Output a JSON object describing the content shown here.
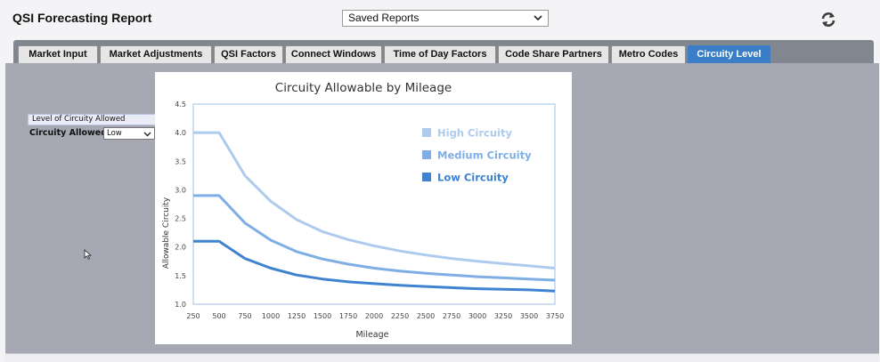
{
  "app": {
    "title": "QSI Forecasting Report",
    "saved_reports_value": "Saved Reports"
  },
  "tabs": [
    {
      "label": "Market Input",
      "active": false
    },
    {
      "label": "Market Adjustments",
      "active": false
    },
    {
      "label": "QSI Factors",
      "active": false
    },
    {
      "label": "Connect Windows",
      "active": false
    },
    {
      "label": "Time of Day Factors",
      "active": false
    },
    {
      "label": "Code Share Partners",
      "active": false
    },
    {
      "label": "Metro Codes",
      "active": false
    },
    {
      "label": "Circuity Level",
      "active": true
    }
  ],
  "circuity_panel": {
    "header": "Level of Circuity Allowed",
    "label": "Circuity Allowed",
    "selected": "Low"
  },
  "icons": {
    "refresh": "refresh-icon",
    "dropdown": "chevron-down-icon",
    "cursor": "mouse-pointer-icon"
  },
  "colors": {
    "tab_active": "#3b7ec8",
    "panel_bg": "#a6a9b3",
    "high": "#aecbee",
    "medium": "#7eaee3",
    "low": "#3f82d0"
  },
  "chart_data": {
    "type": "line",
    "title": "Circuity Allowable by Mileage",
    "xlabel": "Mileage",
    "ylabel": "Allowable Circuity",
    "xlim": [
      250,
      3750
    ],
    "ylim": [
      1.0,
      4.5
    ],
    "xticks": [
      "250",
      "500",
      "750",
      "1000",
      "1250",
      "1500",
      "1750",
      "2000",
      "2250",
      "2500",
      "2750",
      "3000",
      "3250",
      "3500",
      "3750"
    ],
    "yticks": [
      "1.0",
      "1.5",
      "2.0",
      "2.5",
      "3.0",
      "3.5",
      "4.0",
      "4.5"
    ],
    "grid": false,
    "legend_position": "top-right",
    "x": [
      250,
      500,
      750,
      1000,
      1250,
      1500,
      1750,
      2000,
      2250,
      2500,
      2750,
      3000,
      3250,
      3500,
      3750
    ],
    "series": [
      {
        "name": "High Circuity",
        "color": "#aecbee",
        "values": [
          4.0,
          4.0,
          3.25,
          2.8,
          2.48,
          2.27,
          2.13,
          2.02,
          1.93,
          1.86,
          1.8,
          1.75,
          1.71,
          1.67,
          1.63
        ]
      },
      {
        "name": "Medium Circuity",
        "color": "#7eaee3",
        "values": [
          2.9,
          2.9,
          2.42,
          2.12,
          1.92,
          1.79,
          1.7,
          1.63,
          1.58,
          1.54,
          1.51,
          1.48,
          1.46,
          1.44,
          1.42
        ]
      },
      {
        "name": "Low Circuity",
        "color": "#3f82d0",
        "values": [
          2.1,
          2.1,
          1.8,
          1.63,
          1.51,
          1.44,
          1.39,
          1.36,
          1.33,
          1.31,
          1.29,
          1.27,
          1.26,
          1.25,
          1.23
        ]
      }
    ]
  }
}
